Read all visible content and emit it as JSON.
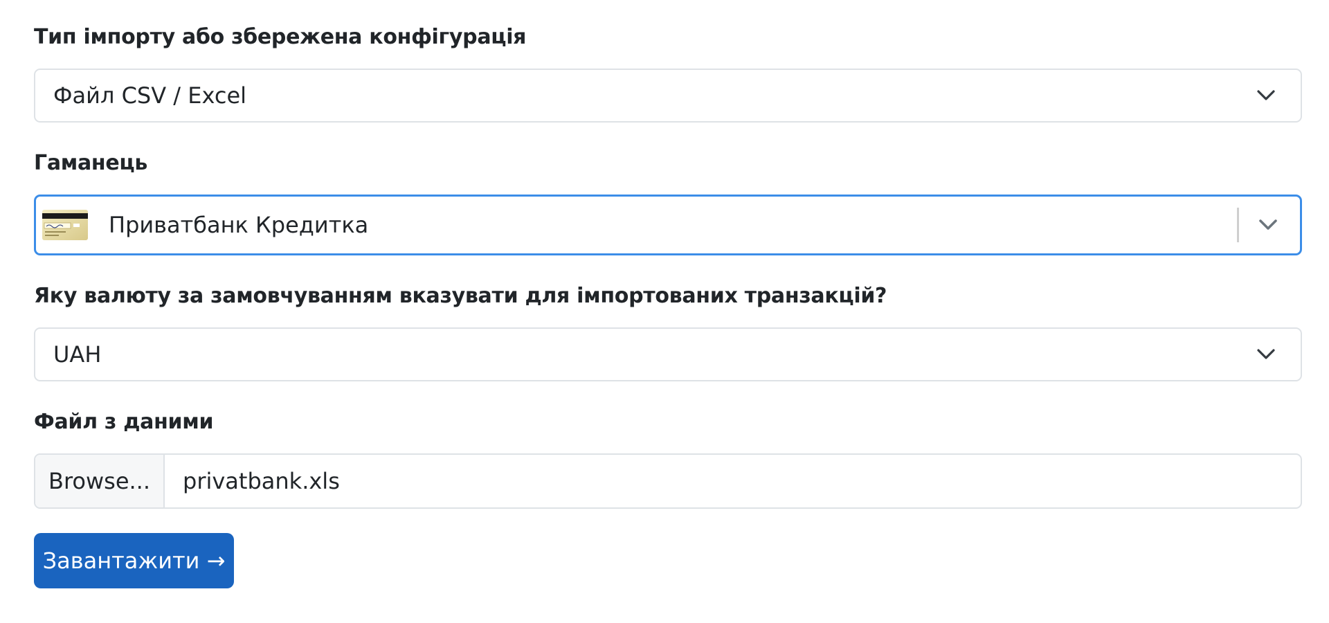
{
  "import_type": {
    "label": "Тип імпорту або збережена конфігурація",
    "value": "Файл CSV / Excel"
  },
  "wallet": {
    "label": "Гаманець",
    "value": "Приватбанк Кредитка",
    "icon": "credit-card-icon"
  },
  "currency": {
    "label": "Яку валюту за замовчуванням вказувати для імпортованих транзакцій?",
    "value": "UAH"
  },
  "file": {
    "label": "Файл з даними",
    "browse_label": "Browse...",
    "filename": "privatbank.xls"
  },
  "submit": {
    "label": "Завантажити →",
    "color": "#1a64bf"
  },
  "colors": {
    "focus_border": "#3b8de8",
    "input_border": "#dee2e6",
    "text": "#212529"
  }
}
